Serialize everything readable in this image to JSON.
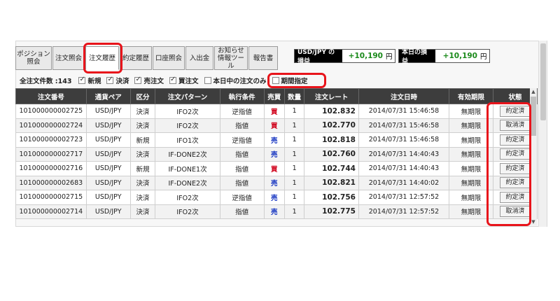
{
  "tabs": [
    {
      "label": "ポジション\n照会"
    },
    {
      "label": "注文照会"
    },
    {
      "label": "注文履歴",
      "active": true
    },
    {
      "label": "約定履歴"
    },
    {
      "label": "口座照会"
    },
    {
      "label": "入出金"
    },
    {
      "label": "お知らせ\n情報ツール"
    },
    {
      "label": "報告書"
    }
  ],
  "pl_boxes": [
    {
      "label": "USD/JPY の損益",
      "value": "+10,190",
      "unit": "円"
    },
    {
      "label": "本日の損益",
      "value": "+10,190",
      "unit": "円"
    }
  ],
  "filters": {
    "total": "全注文件数 :143",
    "checkboxes": [
      {
        "label": "新規",
        "checked": true
      },
      {
        "label": "決済",
        "checked": true
      },
      {
        "label": "売注文",
        "checked": true
      },
      {
        "label": "買注文",
        "checked": true
      },
      {
        "label": "本日中の注文のみ",
        "checked": false
      },
      {
        "label": "期間指定",
        "checked": false
      }
    ]
  },
  "table": {
    "headers": [
      "注文番号",
      "通貨ペア",
      "区分",
      "注文パターン",
      "執行条件",
      "売買",
      "数量",
      "注文レート",
      "注文日時",
      "有効期限",
      "状態"
    ],
    "rows": [
      {
        "id": "101000000002725",
        "pair": "USD/JPY",
        "kubun": "決済",
        "pattern": "IFO2次",
        "cond": "逆指値",
        "side": "買",
        "sideType": "buy",
        "qty": "1",
        "rate": "102.832",
        "datetime": "2014/07/31 15:46:58",
        "expiry": "無期限",
        "status": "約定済"
      },
      {
        "id": "101000000002724",
        "pair": "USD/JPY",
        "kubun": "決済",
        "pattern": "IFO2次",
        "cond": "指値",
        "side": "買",
        "sideType": "buy",
        "qty": "1",
        "rate": "102.770",
        "datetime": "2014/07/31 15:46:58",
        "expiry": "無期限",
        "status": "取消済"
      },
      {
        "id": "101000000002723",
        "pair": "USD/JPY",
        "kubun": "新規",
        "pattern": "IFO1次",
        "cond": "逆指値",
        "side": "売",
        "sideType": "sell",
        "qty": "1",
        "rate": "102.818",
        "datetime": "2014/07/31 15:46:58",
        "expiry": "無期限",
        "status": "約定済"
      },
      {
        "id": "101000000002717",
        "pair": "USD/JPY",
        "kubun": "決済",
        "pattern": "IF-DONE2次",
        "cond": "指値",
        "side": "売",
        "sideType": "sell",
        "qty": "1",
        "rate": "102.760",
        "datetime": "2014/07/31 14:40:43",
        "expiry": "無期限",
        "status": "約定済"
      },
      {
        "id": "101000000002716",
        "pair": "USD/JPY",
        "kubun": "新規",
        "pattern": "IF-DONE1次",
        "cond": "指値",
        "side": "買",
        "sideType": "buy",
        "qty": "1",
        "rate": "102.744",
        "datetime": "2014/07/31 14:40:43",
        "expiry": "無期限",
        "status": "約定済"
      },
      {
        "id": "101000000002683",
        "pair": "USD/JPY",
        "kubun": "決済",
        "pattern": "IF-DONE2次",
        "cond": "指値",
        "side": "売",
        "sideType": "sell",
        "qty": "1",
        "rate": "102.821",
        "datetime": "2014/07/31 14:40:02",
        "expiry": "無期限",
        "status": "約定済"
      },
      {
        "id": "101000000002715",
        "pair": "USD/JPY",
        "kubun": "決済",
        "pattern": "IFO2次",
        "cond": "逆指値",
        "side": "売",
        "sideType": "sell",
        "qty": "1",
        "rate": "102.756",
        "datetime": "2014/07/31 12:57:52",
        "expiry": "無期限",
        "status": "約定済"
      },
      {
        "id": "101000000002714",
        "pair": "USD/JPY",
        "kubun": "決済",
        "pattern": "IFO2次",
        "cond": "指値",
        "side": "売",
        "sideType": "sell",
        "qty": "1",
        "rate": "102.775",
        "datetime": "2014/07/31 12:57:52",
        "expiry": "無期限",
        "status": "取消済"
      }
    ]
  },
  "colors": {
    "highlight": "#e8141b",
    "buy": "#d0021b",
    "sell": "#1030c0",
    "profit": "#1a8a1a"
  }
}
